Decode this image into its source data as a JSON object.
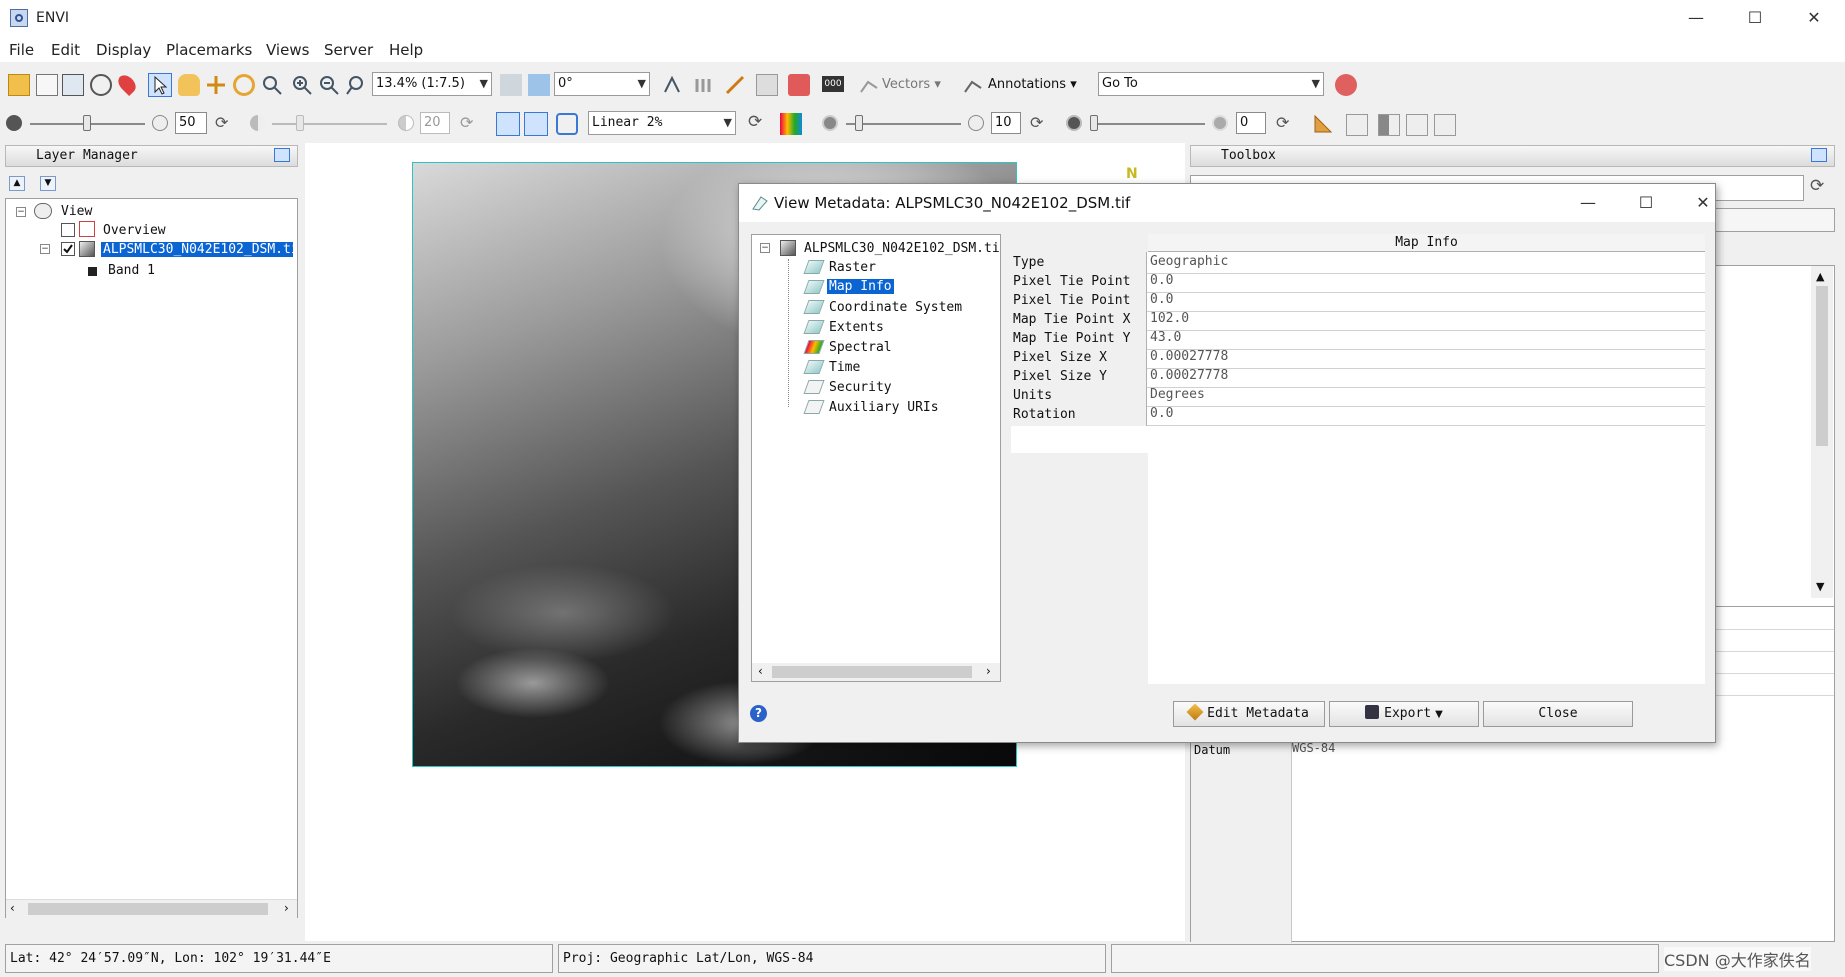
{
  "app": {
    "title": "ENVI"
  },
  "window_controls": {
    "minimize": "—",
    "maximize": "☐",
    "close": "✕"
  },
  "menubar": [
    "File",
    "Edit",
    "Display",
    "Placemarks",
    "Views",
    "Server",
    "Help"
  ],
  "toolbar1": {
    "zoom_value": "13.4% (1:7.5)",
    "rotation_value": "0°",
    "vectors_label": "Vectors",
    "annotations_label": "Annotations",
    "goto_value": "Go To"
  },
  "toolbar2": {
    "brightness_value": "50",
    "contrast_value": "20",
    "stretch_value": "Linear 2%",
    "sharpen_value": "10",
    "transparency_value": "0"
  },
  "layer_manager": {
    "title": "Layer Manager",
    "tree": {
      "view": "View",
      "overview": "Overview",
      "layer": "ALPSMLC30_N042E102_DSM.tif",
      "band": "Band 1"
    }
  },
  "view": {
    "north_label": "N"
  },
  "toolbox": {
    "title": "Toolbox",
    "datum_key": "Datum",
    "datum_value": "WGS-84"
  },
  "status": {
    "latlon": "Lat: 42° 24′57.09″N, Lon: 102° 19′31.44″E",
    "proj": "Proj: Geographic Lat/Lon, WGS-84",
    "watermark": "CSDN @大作家佚名"
  },
  "dialog": {
    "title": "View Metadata: ALPSMLC30_N042E102_DSM.tif",
    "tree_root": "ALPSMLC30_N042E102_DSM.tif",
    "tree_items": [
      "Raster",
      "Map Info",
      "Coordinate System",
      "Extents",
      "Spectral",
      "Time",
      "Security",
      "Auxiliary URIs"
    ],
    "selected_item": "Map Info",
    "table_header": "Map Info",
    "rows": [
      {
        "key": "Type",
        "value": "Geographic"
      },
      {
        "key": "Pixel Tie Point X",
        "value": "0.0"
      },
      {
        "key": "Pixel Tie Point Y",
        "value": "0.0"
      },
      {
        "key": "Map Tie Point X",
        "value": "102.0"
      },
      {
        "key": "Map Tie Point Y",
        "value": "43.0"
      },
      {
        "key": "Pixel Size X",
        "value": "0.00027778"
      },
      {
        "key": "Pixel Size Y",
        "value": "0.00027778"
      },
      {
        "key": "Units",
        "value": "Degrees"
      },
      {
        "key": "Rotation",
        "value": "0.0"
      }
    ],
    "buttons": {
      "edit": "Edit Metadata",
      "export": "Export",
      "close": "Close"
    },
    "help_icon": "?"
  }
}
